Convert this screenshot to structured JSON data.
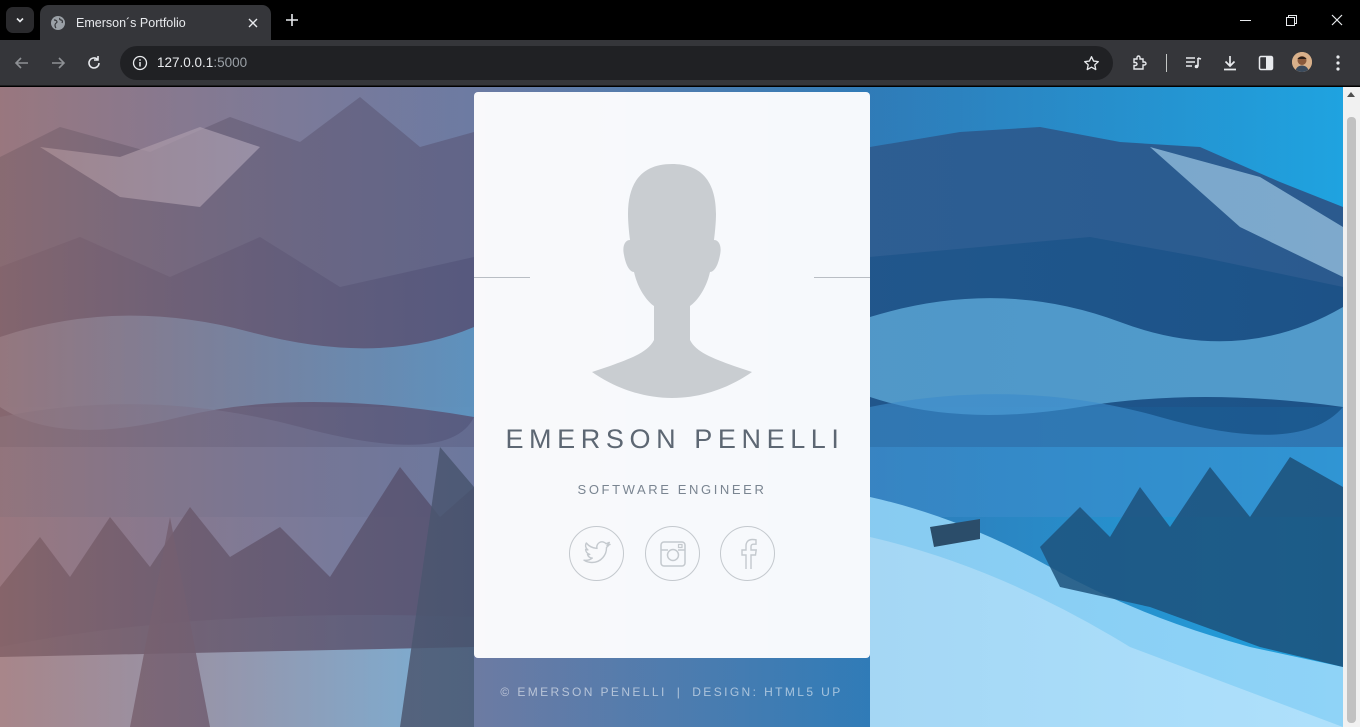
{
  "browser": {
    "tab_title": "Emerson´s Portfolio",
    "url_host": "127.0.0.1",
    "url_port": ":5000"
  },
  "profile": {
    "name": "EMERSON PENELLI",
    "role": "SOFTWARE ENGINEER",
    "socials": [
      {
        "icon": "twitter-icon"
      },
      {
        "icon": "instagram-icon"
      },
      {
        "icon": "facebook-icon"
      }
    ]
  },
  "footer": {
    "copyright": "© EMERSON PENELLI",
    "separator": "|",
    "design": "DESIGN: HTML5 UP"
  },
  "colors": {
    "accent_text": "#5d6773",
    "card_bg": "#ffffff",
    "chrome_bg": "#35363a"
  }
}
